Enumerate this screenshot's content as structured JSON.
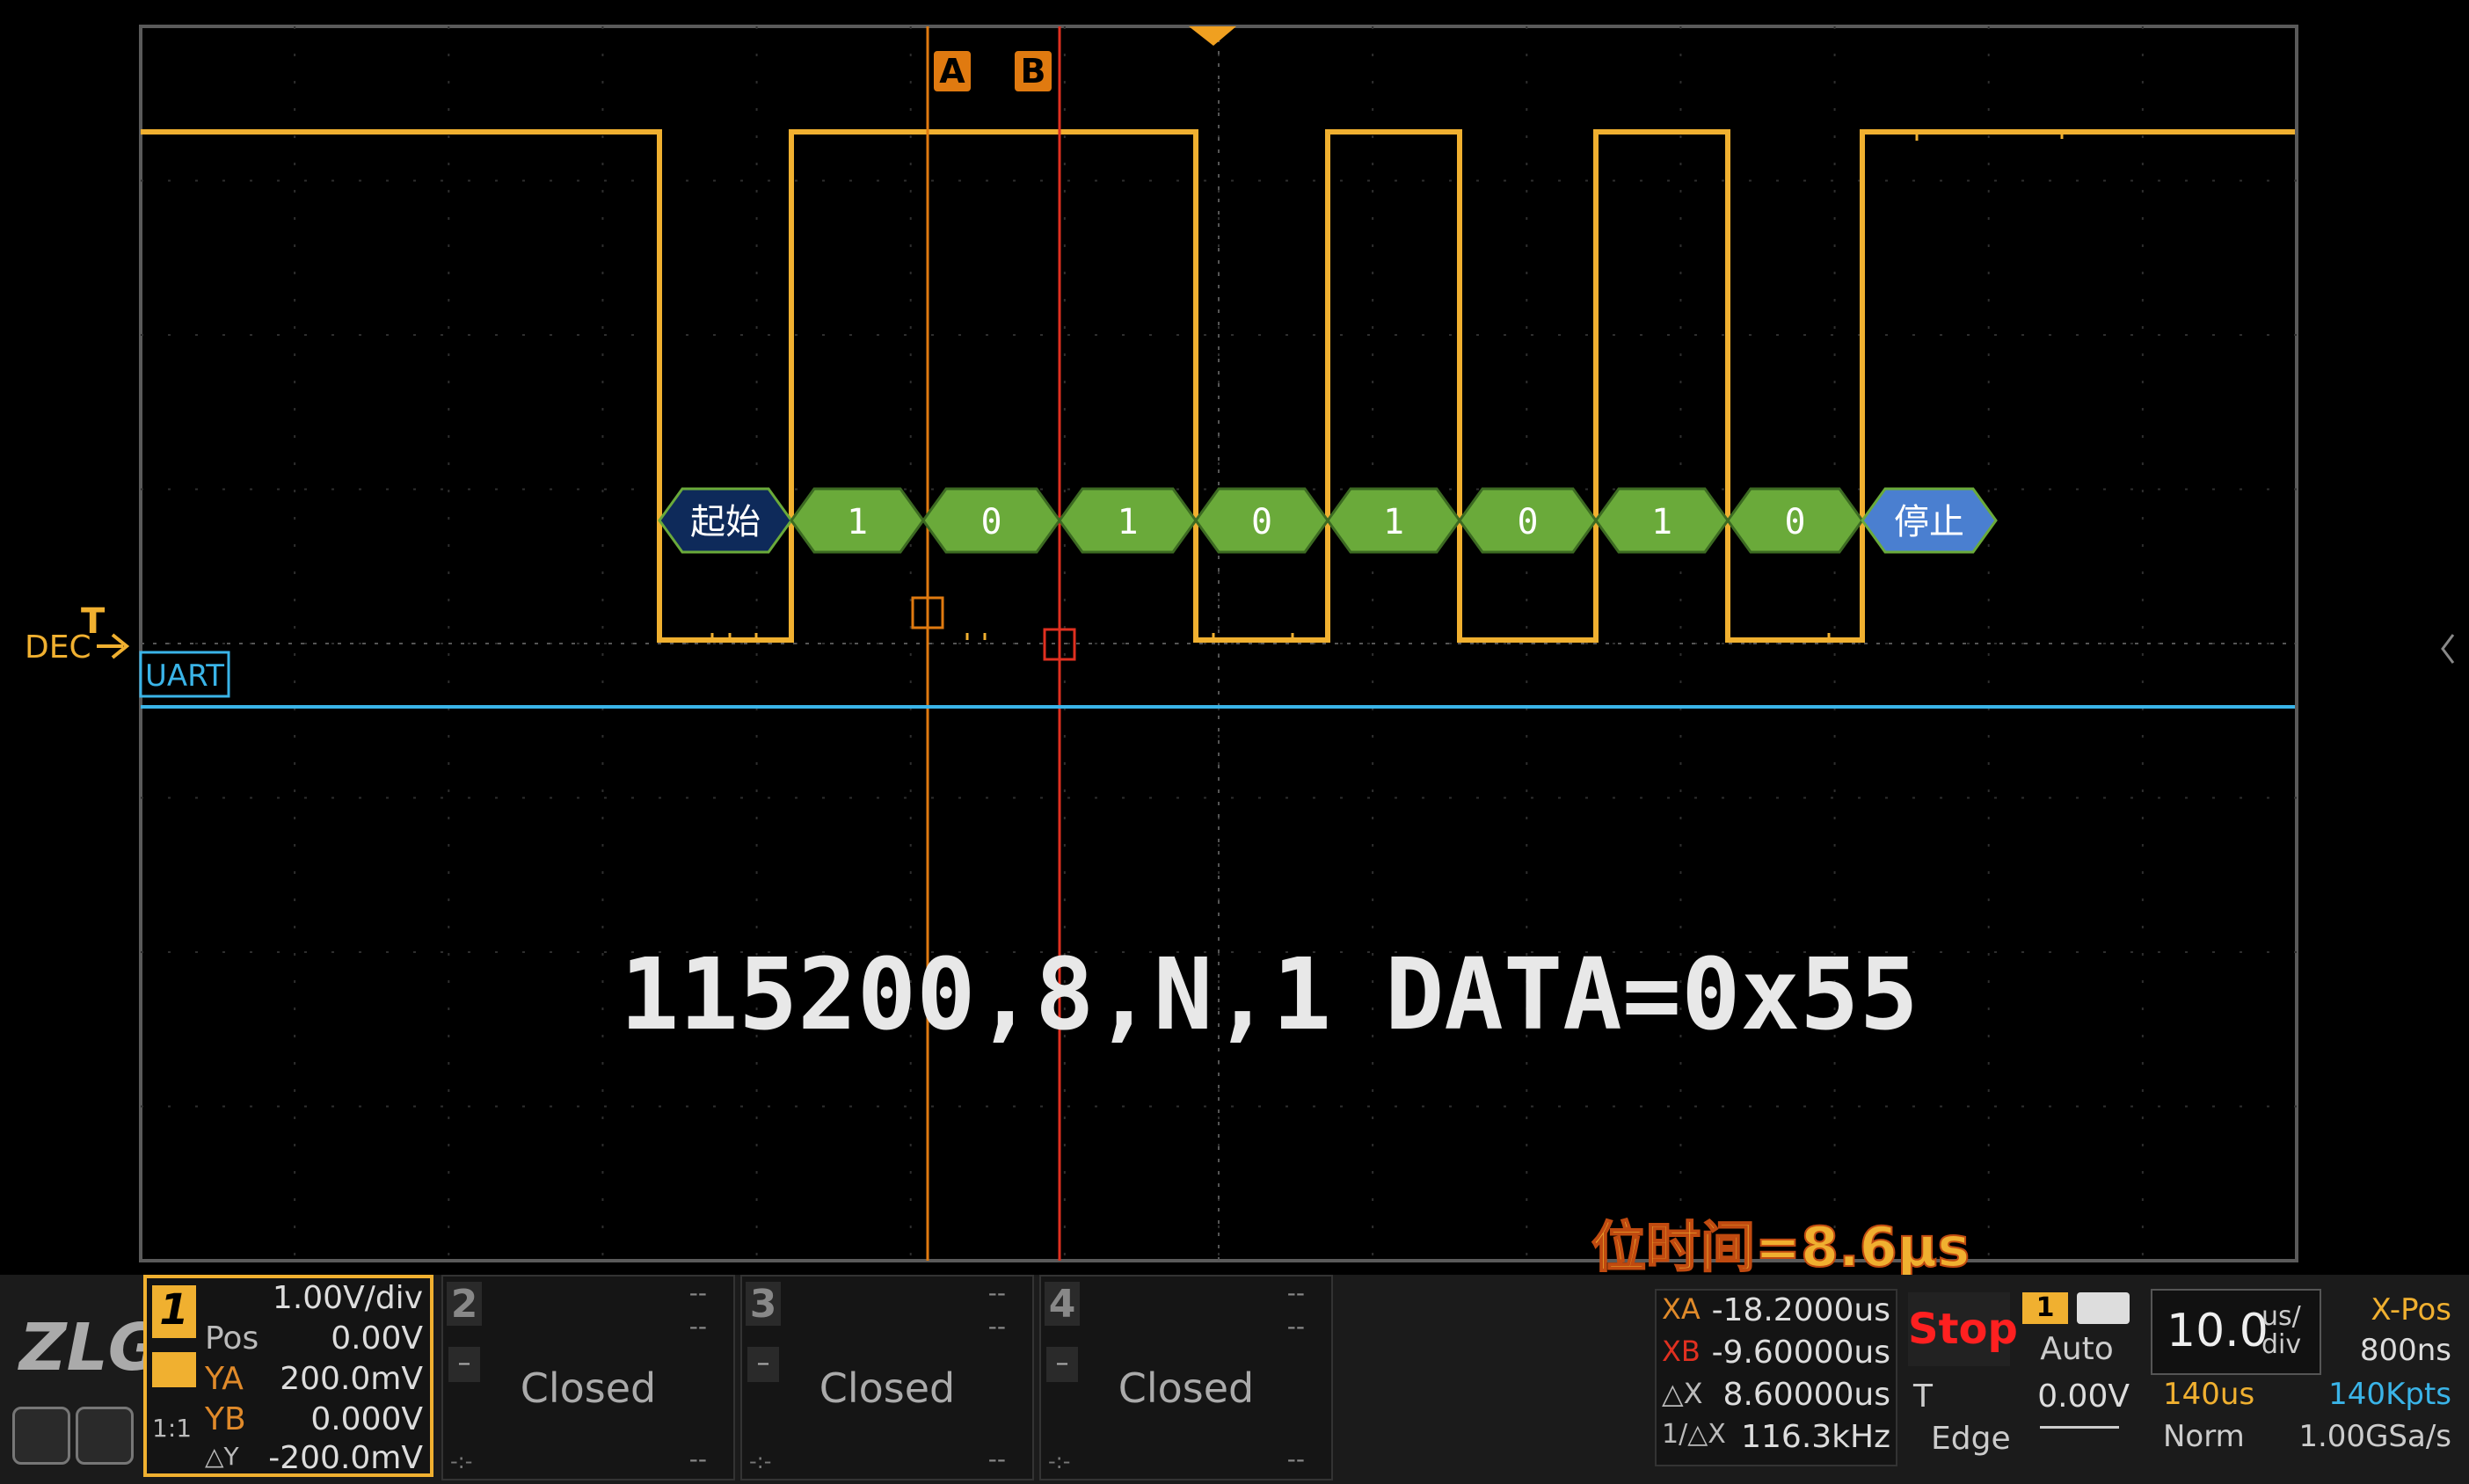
{
  "overlay": {
    "params": "115200,8,N,1",
    "data_value": "DATA=0x55",
    "bit_time": "位时间=8.6μs"
  },
  "cursors": {
    "a_label": "A",
    "b_label": "B"
  },
  "channel_label": {
    "dec": "DEC",
    "uart": "UART"
  },
  "decode": [
    {
      "text": "起始",
      "kind": "start"
    },
    {
      "text": "1",
      "kind": "data"
    },
    {
      "text": "0",
      "kind": "data"
    },
    {
      "text": "1",
      "kind": "data"
    },
    {
      "text": "0",
      "kind": "data"
    },
    {
      "text": "1",
      "kind": "data"
    },
    {
      "text": "0",
      "kind": "data"
    },
    {
      "text": "1",
      "kind": "data"
    },
    {
      "text": "0",
      "kind": "data"
    },
    {
      "text": "停止",
      "kind": "stop"
    }
  ],
  "colors": {
    "trace": "#f0b030",
    "grid": "#3a3a3a",
    "cursor_a": "#e07a10",
    "cursor_b": "#e03020",
    "uart_line": "#3ab4e8",
    "decode_start": "#0e2a5a",
    "decode_data": "#6aaa3a",
    "decode_stop": "#4a7fd0"
  },
  "ch1": {
    "num": "1",
    "scale": "1.00V/div",
    "pos_label": "Pos",
    "pos_value": "0.00V",
    "ya_label": "YA",
    "ya_value": "200.0mV",
    "yb_label": "YB",
    "yb_value": "0.000V",
    "dy_label": "△Y",
    "dy_value": "-200.0mV",
    "ratio": "1:1"
  },
  "channels": [
    {
      "num": "2",
      "dash1": "--",
      "dash2": "--",
      "status": "Closed",
      "foot": "-:-",
      "foot_r": "--"
    },
    {
      "num": "3",
      "dash1": "--",
      "dash2": "--",
      "status": "Closed",
      "foot": "-:-",
      "foot_r": "--"
    },
    {
      "num": "4",
      "dash1": "--",
      "dash2": "--",
      "status": "Closed",
      "foot": "-:-",
      "foot_r": "--"
    }
  ],
  "measure": {
    "xa_label": "XA",
    "xa_value": "-18.2000us",
    "xb_label": "XB",
    "xb_value": "-9.60000us",
    "dx_label": "△X",
    "dx_value": "8.60000us",
    "inv_label": "1/△X",
    "inv_value": "116.3kHz"
  },
  "run": {
    "state": "Stop",
    "badge": "1",
    "mode": "Auto",
    "t_label": "T",
    "t_value": "0.00V",
    "trigger": "Edge"
  },
  "timebase": {
    "value": "10.0",
    "unit_top": "us/",
    "unit_bot": "div",
    "xpos_label": "X-Pos",
    "xpos_value": "800ns",
    "window": "140us",
    "points": "140Kpts",
    "acq": "Norm",
    "rate": "1.00GSa/s"
  },
  "brand": "ZLG"
}
